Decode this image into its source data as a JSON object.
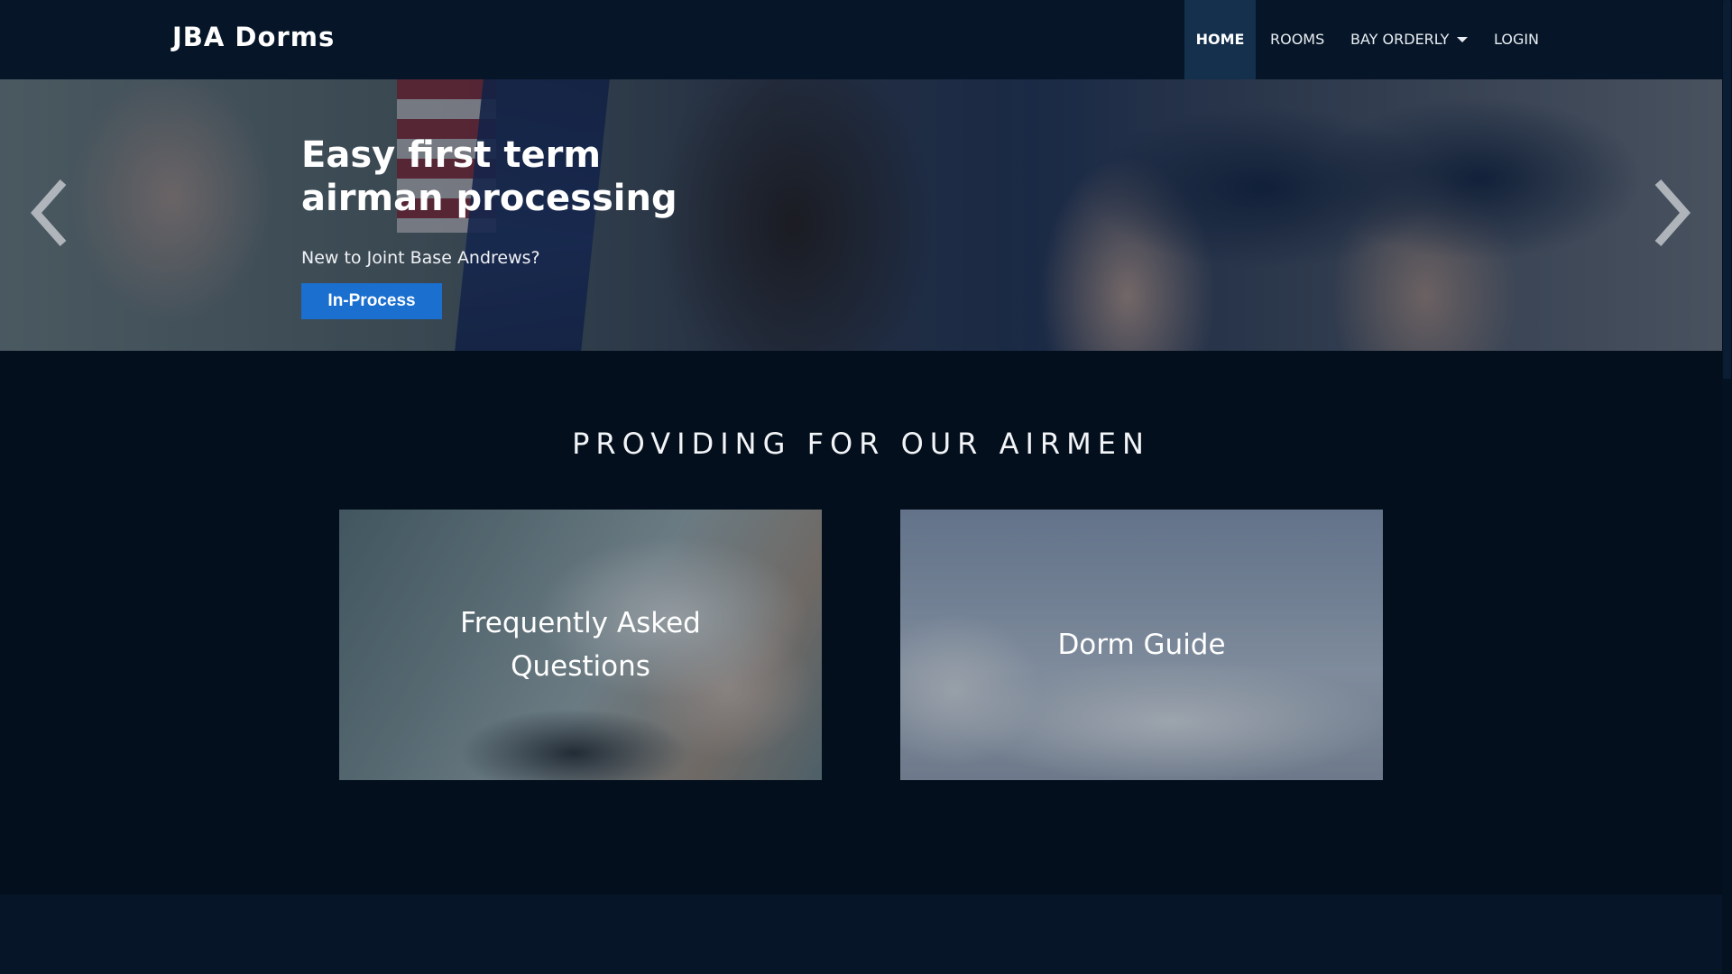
{
  "brand": {
    "name": "JBA Dorms"
  },
  "nav": {
    "home": "HOME",
    "rooms": "ROOMS",
    "bay_orderly": "BAY ORDERLY",
    "login": "LOGIN"
  },
  "hero": {
    "title": "Easy first term airman processing",
    "subtitle": "New to Joint Base Andrews?",
    "button_label": "In-Process",
    "prev_icon": "chevron-left-icon",
    "next_icon": "chevron-right-icon"
  },
  "main": {
    "section_title": "PROVIDING FOR OUR AIRMEN",
    "cards": [
      {
        "label": "Frequently Asked Questions"
      },
      {
        "label": "Dorm Guide"
      }
    ]
  },
  "colors": {
    "nav_bg": "#061628",
    "nav_active_bg": "#14304d",
    "page_bg": "#030f1c",
    "button_bg": "#1a6fcf"
  }
}
